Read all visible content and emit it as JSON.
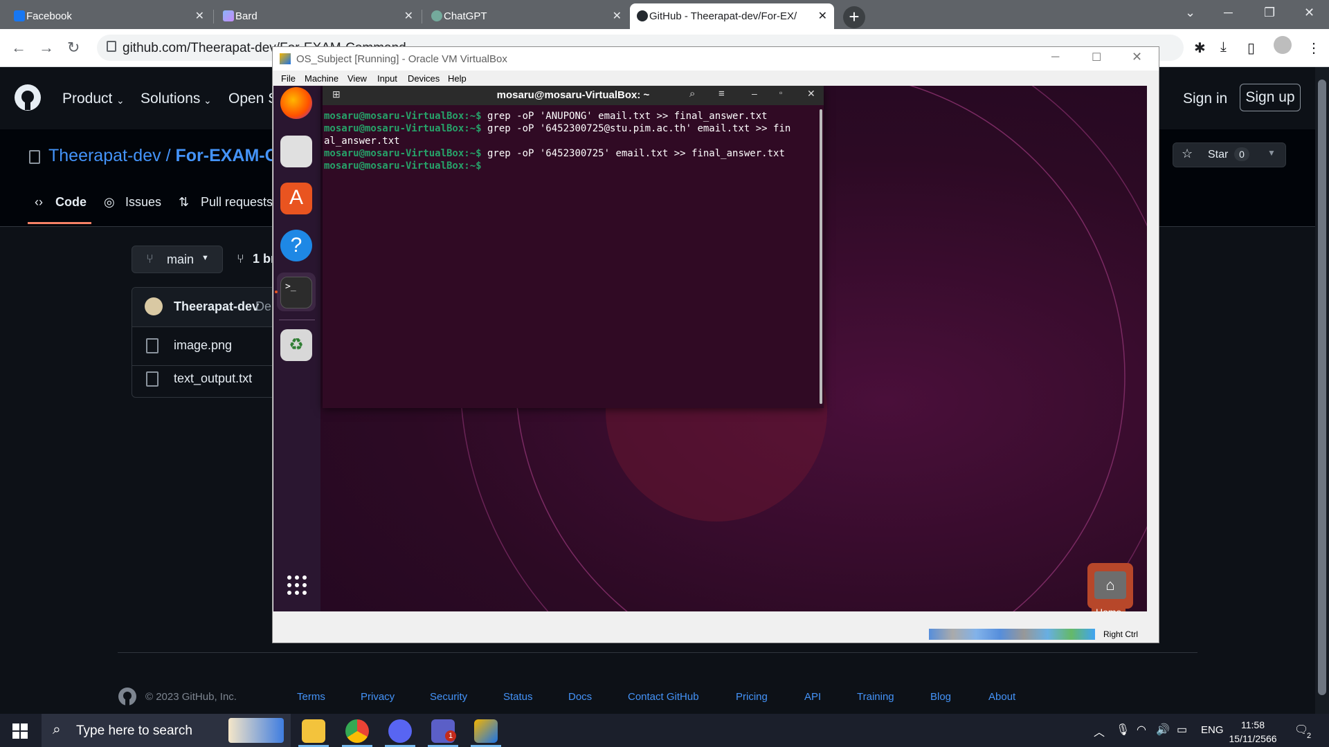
{
  "browser": {
    "tabs": [
      {
        "label": "Facebook",
        "active": false
      },
      {
        "label": "Bard",
        "active": false
      },
      {
        "label": "ChatGPT",
        "active": false
      },
      {
        "label": "GitHub - Theerapat-dev/For-EX/",
        "active": true
      }
    ],
    "url": "github.com/Theerapat-dev/For-EXAM-Command"
  },
  "github": {
    "nav": [
      "Product",
      "Solutions",
      "Open S"
    ],
    "sign_in": "Sign in",
    "sign_up": "Sign up",
    "repo_owner": "Theerapat-dev",
    "repo_sep": "/",
    "repo_name": "For-EXAM-Co",
    "tabs": [
      "Code",
      "Issues",
      "Pull requests"
    ],
    "star_label": "Star",
    "star_count": "0",
    "branch": "main",
    "branches_label": "1 br",
    "commit_author": "Theerapat-dev",
    "commit_msg": "Del",
    "files": [
      "image.png",
      "text_output.txt"
    ],
    "copyright": "© 2023 GitHub, Inc.",
    "footer_links": [
      "Terms",
      "Privacy",
      "Security",
      "Status",
      "Docs",
      "Contact GitHub",
      "Pricing",
      "API",
      "Training",
      "Blog",
      "About"
    ]
  },
  "vbox": {
    "title": "OS_Subject [Running] - Oracle VM VirtualBox",
    "menu": [
      "File",
      "Machine",
      "View",
      "Input",
      "Devices",
      "Help"
    ],
    "status_key": "Right Ctrl"
  },
  "terminal": {
    "title": "mosaru@mosaru-VirtualBox: ~",
    "prompt": "mosaru@mosaru-VirtualBox:~$",
    "lines": [
      {
        "prompt": "mosaru@mosaru-VirtualBox:~$",
        "cmd": " grep -oP 'ANUPONG' email.txt >> final_answer.txt"
      },
      {
        "prompt": "mosaru@mosaru-VirtualBox:~$",
        "cmd": " grep -oP '6452300725@stu.pim.ac.th' email.txt >> fin"
      },
      {
        "prompt": "",
        "cmd": "al_answer.txt"
      },
      {
        "prompt": "mosaru@mosaru-VirtualBox:~$",
        "cmd": " grep -oP '6452300725' email.txt >> final_answer.txt"
      },
      {
        "prompt": "mosaru@mosaru-VirtualBox:~$",
        "cmd": " "
      }
    ],
    "desktop_home_label": "Home"
  },
  "taskbar": {
    "search_placeholder": "Type here to search",
    "language": "ENG",
    "time": "11:58",
    "date": "15/11/2566",
    "notification_count": "2",
    "teams_badge": "1"
  }
}
